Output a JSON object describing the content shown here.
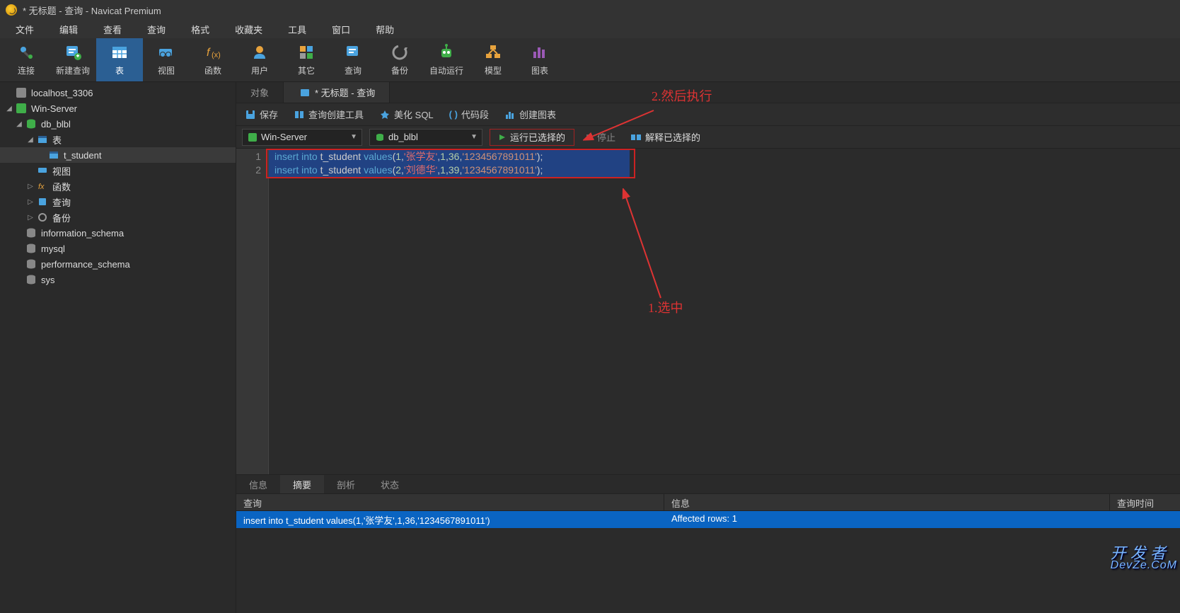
{
  "title": "* 无标题 - 查询 - Navicat Premium",
  "menu": [
    "文件",
    "编辑",
    "查看",
    "查询",
    "格式",
    "收藏夹",
    "工具",
    "窗口",
    "帮助"
  ],
  "toolbar": [
    {
      "id": "connect",
      "label": "连接"
    },
    {
      "id": "newquery",
      "label": "新建查询"
    },
    {
      "id": "table",
      "label": "表",
      "active": true
    },
    {
      "id": "view",
      "label": "视图"
    },
    {
      "id": "function",
      "label": "函数"
    },
    {
      "id": "user",
      "label": "用户"
    },
    {
      "id": "other",
      "label": "其它"
    },
    {
      "id": "query",
      "label": "查询"
    },
    {
      "id": "backup",
      "label": "备份"
    },
    {
      "id": "autorun",
      "label": "自动运行"
    },
    {
      "id": "model",
      "label": "模型"
    },
    {
      "id": "chart",
      "label": "图表"
    }
  ],
  "sidebar": {
    "conn1": "localhost_3306",
    "conn2": "Win-Server",
    "db": "db_blbl",
    "tables_label": "表",
    "table1": "t_student",
    "views": "视图",
    "funcs": "函数",
    "queries": "查询",
    "backups": "备份",
    "db2": "information_schema",
    "db3": "mysql",
    "db4": "performance_schema",
    "db5": "sys"
  },
  "tabs": {
    "objects": "对象",
    "query_title": "* 无标题 - 查询"
  },
  "qtool": {
    "save": "保存",
    "builder": "查询创建工具",
    "beautify": "美化 SQL",
    "snippet": "代码段",
    "chart": "创建图表"
  },
  "conn": {
    "server": "Win-Server",
    "db": "db_blbl",
    "run": "运行已选择的",
    "stop": "停止",
    "explain": "解释已选择的"
  },
  "code": {
    "lines": [
      {
        "n": "1",
        "pre": "insert into ",
        "tbl": "t_student ",
        "fn": "values",
        "open": "(",
        "v1": "1",
        "c": ",",
        "s1": "'张学友'",
        "v2": "1",
        "v3": "36",
        "s2": "'1234567891011'",
        "close": ");"
      },
      {
        "n": "2",
        "pre": "insert into ",
        "tbl": "t_student ",
        "fn": "values",
        "open": "(",
        "v1": "2",
        "c": ",",
        "s1": "'刘德华'",
        "v2": "1",
        "v3": "39",
        "s2": "'1234567891011'",
        "close": ");"
      }
    ]
  },
  "btabs": [
    "信息",
    "摘要",
    "剖析",
    "状态"
  ],
  "result": {
    "h1": "查询",
    "h2": "信息",
    "h3": "查询时间",
    "q": "insert into t_student values(1,'张学友',1,36,'1234567891011')",
    "info": "Affected rows: 1"
  },
  "anno": {
    "a2": "2.然后执行",
    "a1": "1.选中"
  },
  "watermark": {
    "l1": "开 发 者",
    "l2": "DevZe.CoM"
  }
}
